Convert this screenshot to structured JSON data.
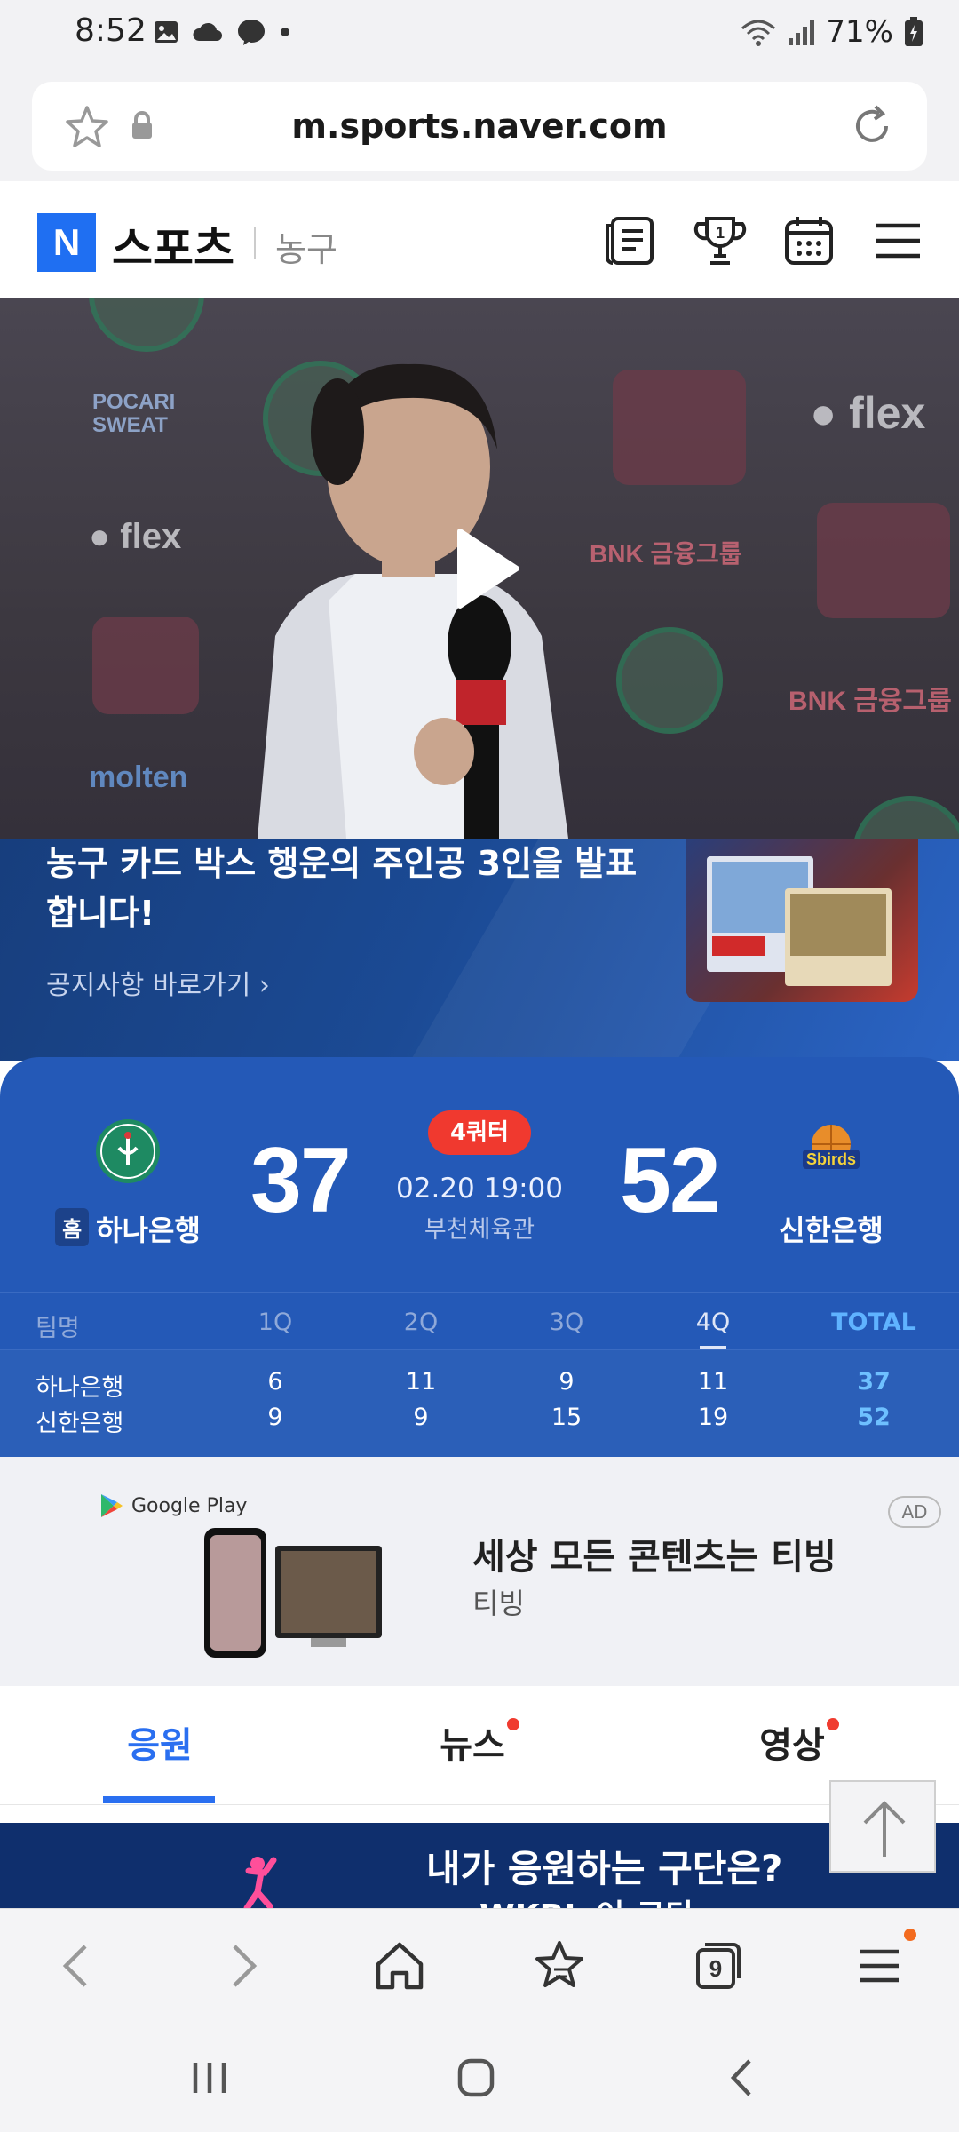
{
  "status_bar": {
    "time": "8:52",
    "battery": "71%",
    "left_icons": [
      "image-icon",
      "cloud-icon",
      "messenger-icon",
      "dot-icon"
    ],
    "right_icons": [
      "wifi-icon",
      "signal-icon",
      "battery-icon"
    ]
  },
  "browser": {
    "url": "m.sports.naver.com"
  },
  "naver_header": {
    "logo": "N",
    "title": "스포츠",
    "section": "농구"
  },
  "promo": {
    "title": "농구 카드 박스 행운의 주인공 3인을 발표합니다!",
    "link_label": "공지사항 바로가기 ›"
  },
  "game": {
    "home_badge": "홈",
    "home_team": "하나은행",
    "away_team": "신한은행",
    "home_score": "37",
    "away_score": "52",
    "status": "4쿼터",
    "datetime": "02.20 19:00",
    "venue": "부천체육관",
    "quarter_table": {
      "headers": [
        "팀명",
        "1Q",
        "2Q",
        "3Q",
        "4Q",
        "TOTAL"
      ],
      "rows": [
        [
          "하나은행",
          "6",
          "11",
          "9",
          "11",
          "37"
        ],
        [
          "신한은행",
          "9",
          "9",
          "15",
          "19",
          "52"
        ]
      ]
    }
  },
  "ad": {
    "store_label": "Google Play",
    "title": "세상 모든 콘텐츠는 티빙",
    "advertiser": "티빙",
    "badge": "AD"
  },
  "tabs": [
    {
      "label": "응원",
      "active": true,
      "new": false
    },
    {
      "label": "뉴스",
      "active": false,
      "new": true
    },
    {
      "label": "영상",
      "active": false,
      "new": true
    }
  ],
  "fan_banner": {
    "text": "내가 응원하는 구단은?",
    "sub": "WKBL 이 구단"
  },
  "colors": {
    "naver_blue": "#1f6ff2",
    "score_bg": "#2459b7",
    "live_red": "#f0392f",
    "tab_active": "#2a6ff0"
  }
}
